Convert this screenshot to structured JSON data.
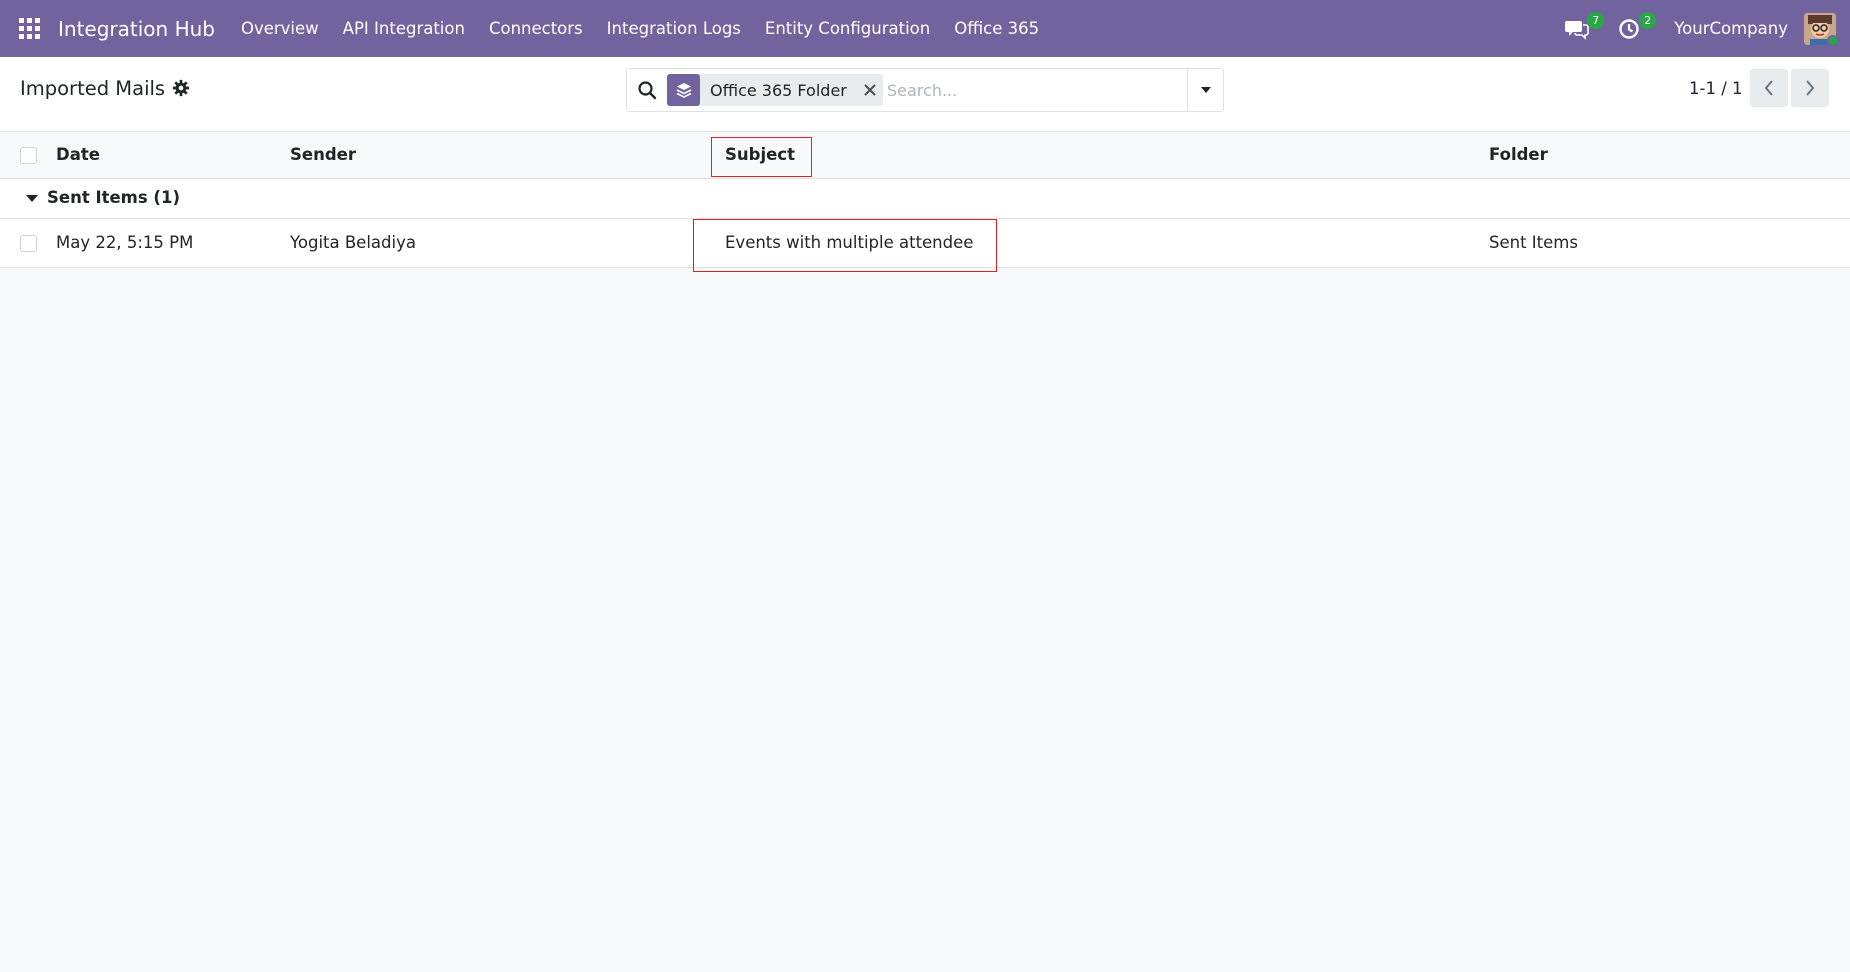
{
  "navbar": {
    "brand": "Integration Hub",
    "menu": [
      "Overview",
      "API Integration",
      "Connectors",
      "Integration Logs",
      "Entity Configuration",
      "Office 365"
    ],
    "messages_count": "7",
    "activities_count": "2",
    "company": "YourCompany",
    "accent_color": "#71639e"
  },
  "control_panel": {
    "title": "Imported Mails",
    "search": {
      "facet_label": "Office 365 Folder",
      "placeholder": "Search..."
    },
    "pager": "1-1 / 1"
  },
  "table": {
    "columns": [
      "Date",
      "Sender",
      "Subject",
      "Folder"
    ],
    "groups": [
      {
        "label": "Sent Items (1)",
        "rows": [
          {
            "date": "May 22, 5:15 PM",
            "sender": "Yogita Beladiya",
            "subject": "Events with multiple attendee",
            "folder": "Sent Items"
          }
        ]
      }
    ]
  },
  "annotation_color": "#e02020"
}
